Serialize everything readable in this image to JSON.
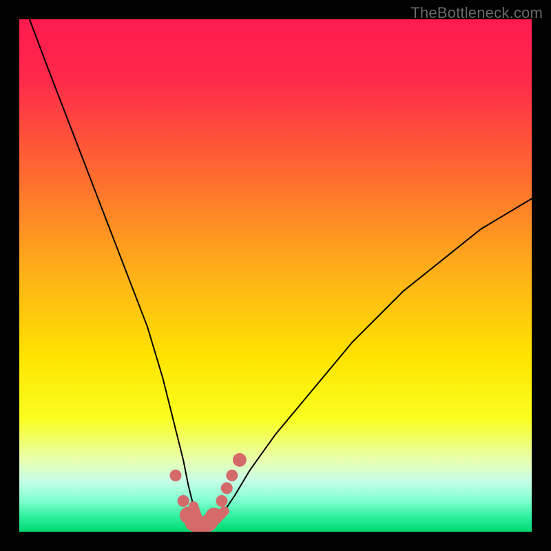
{
  "watermark": "TheBottleneck.com",
  "colors": {
    "frame": "#000000",
    "gradient_stops": [
      {
        "offset": 0.0,
        "color": "#ff1a4f"
      },
      {
        "offset": 0.12,
        "color": "#ff2a4a"
      },
      {
        "offset": 0.3,
        "color": "#ff6a30"
      },
      {
        "offset": 0.5,
        "color": "#ffb218"
      },
      {
        "offset": 0.66,
        "color": "#ffe400"
      },
      {
        "offset": 0.78,
        "color": "#faff20"
      },
      {
        "offset": 0.86,
        "color": "#e8ffb0"
      },
      {
        "offset": 0.9,
        "color": "#c8ffe8"
      },
      {
        "offset": 0.94,
        "color": "#80ffd0"
      },
      {
        "offset": 0.97,
        "color": "#30f0a0"
      },
      {
        "offset": 1.0,
        "color": "#00d870"
      }
    ],
    "curve": "#000000",
    "marker_fill": "#d46a6a",
    "marker_stroke": "#d46a6a"
  },
  "chart_data": {
    "type": "line",
    "title": "",
    "xlabel": "",
    "ylabel": "",
    "xlim": [
      0,
      100
    ],
    "ylim": [
      0,
      100
    ],
    "series": [
      {
        "name": "bottleneck-curve",
        "x": [
          2,
          5,
          10,
          15,
          20,
          25,
          28,
          30,
          32,
          33,
          34,
          35,
          36,
          37,
          38,
          40,
          42,
          45,
          50,
          55,
          60,
          65,
          70,
          75,
          80,
          85,
          90,
          95,
          100
        ],
        "y": [
          100,
          92,
          79,
          66,
          53,
          40,
          30,
          22,
          14,
          9,
          5,
          2,
          1,
          1,
          2,
          4,
          7,
          12,
          19,
          25,
          31,
          37,
          42,
          47,
          51,
          55,
          59,
          62,
          65
        ]
      }
    ],
    "markers": [
      {
        "x": 30.5,
        "y": 11,
        "r": 1.2
      },
      {
        "x": 32.0,
        "y": 6,
        "r": 1.2
      },
      {
        "x": 33.0,
        "y": 3.2,
        "r": 1.8
      },
      {
        "x": 34.0,
        "y": 1.8,
        "r": 1.8
      },
      {
        "x": 35.0,
        "y": 1.2,
        "r": 1.8
      },
      {
        "x": 36.0,
        "y": 1.2,
        "r": 1.8
      },
      {
        "x": 37.0,
        "y": 1.8,
        "r": 1.8
      },
      {
        "x": 38.0,
        "y": 3.0,
        "r": 1.8
      },
      {
        "x": 39.5,
        "y": 6.0,
        "r": 1.2
      },
      {
        "x": 40.5,
        "y": 8.5,
        "r": 1.2
      },
      {
        "x": 41.5,
        "y": 11.0,
        "r": 1.2
      },
      {
        "x": 43.0,
        "y": 14.0,
        "r": 1.4
      }
    ]
  }
}
